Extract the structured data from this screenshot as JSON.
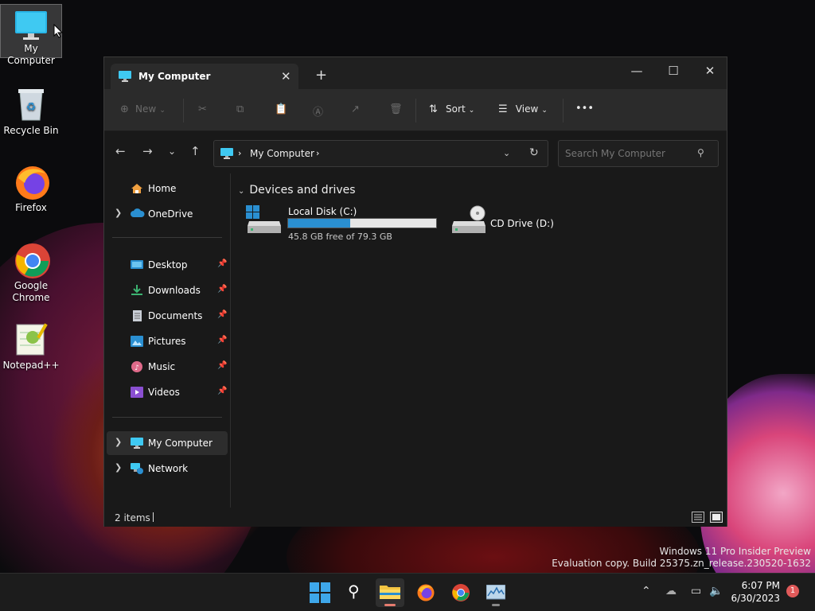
{
  "desktop": {
    "icons": [
      {
        "label": "My Computer"
      },
      {
        "label": "Recycle Bin"
      },
      {
        "label": "Firefox"
      },
      {
        "label": "Google\nChrome"
      },
      {
        "label": "Notepad++"
      }
    ]
  },
  "window": {
    "tab_title": "My Computer",
    "tab_close": "✕",
    "new_tab": "+",
    "minimize": "—",
    "maximize": "☐",
    "close": "✕"
  },
  "toolbar": {
    "new_label": "New",
    "sort_label": "Sort",
    "view_label": "View",
    "more_label": "•••"
  },
  "navbar": {
    "address_text": "My Computer",
    "search_placeholder": "Search My Computer"
  },
  "sidebar": {
    "items": [
      {
        "label": "Home"
      },
      {
        "label": "OneDrive"
      },
      {
        "label": "Desktop"
      },
      {
        "label": "Downloads"
      },
      {
        "label": "Documents"
      },
      {
        "label": "Pictures"
      },
      {
        "label": "Music"
      },
      {
        "label": "Videos"
      },
      {
        "label": "My Computer"
      },
      {
        "label": "Network"
      }
    ]
  },
  "content": {
    "group_header": "Devices and drives",
    "drives": [
      {
        "name": "Local Disk (C:)",
        "free_text": "45.8 GB free of 79.3 GB",
        "used_fraction": 0.42
      },
      {
        "name": "CD Drive (D:)"
      }
    ]
  },
  "status": {
    "items_count": "2 items"
  },
  "watermark": {
    "line1": "Windows 11 Pro Insider Preview",
    "line2": "Evaluation copy. Build 25375.zn_release.230520-1632"
  },
  "taskbar": {
    "time": "6:07 PM",
    "date": "6/30/2023",
    "notifications": "1"
  },
  "colors": {
    "accent": "#2a8fd1",
    "window_bg": "#191919",
    "toolbar_bg": "#2b2b2b"
  }
}
